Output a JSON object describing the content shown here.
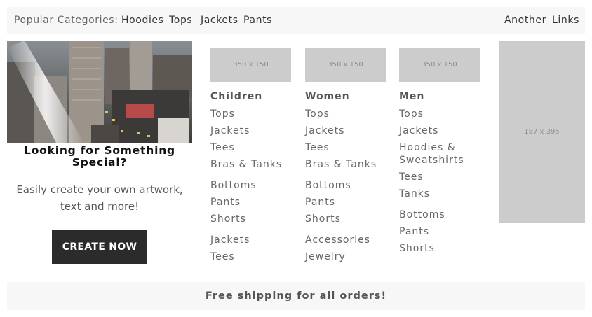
{
  "topbar": {
    "label": "Popular Categories:",
    "links": [
      "Hoodies",
      "Tops",
      "Jackets",
      "Pants"
    ],
    "right_links": [
      "Another",
      "Links"
    ]
  },
  "promo": {
    "title": "Looking for Something Special?",
    "text": "Easily create your own artwork, text and more!",
    "button": "CREATE NOW"
  },
  "columns": [
    {
      "thumb": "350 x 150",
      "title": "Children",
      "groups": [
        [
          "Tops",
          "Jackets",
          "Tees",
          "Bras & Tanks"
        ],
        [
          "Bottoms",
          "Pants",
          "Shorts"
        ],
        [
          "Jackets",
          "Tees"
        ]
      ]
    },
    {
      "thumb": "350 x 150",
      "title": "Women",
      "groups": [
        [
          "Tops",
          "Jackets",
          "Tees",
          "Bras & Tanks"
        ],
        [
          "Bottoms",
          "Pants",
          "Shorts"
        ],
        [
          "Accessories",
          "Jewelry"
        ]
      ]
    },
    {
      "thumb": "350 x 150",
      "title": "Men",
      "groups": [
        [
          "Tops",
          "Jackets",
          "Hoodies & Sweatshirts",
          "Tees",
          "Tanks"
        ],
        [
          "Bottoms",
          "Pants",
          "Shorts"
        ]
      ]
    }
  ],
  "side_ad": "187 x 395",
  "footer": "Free shipping for all orders!"
}
